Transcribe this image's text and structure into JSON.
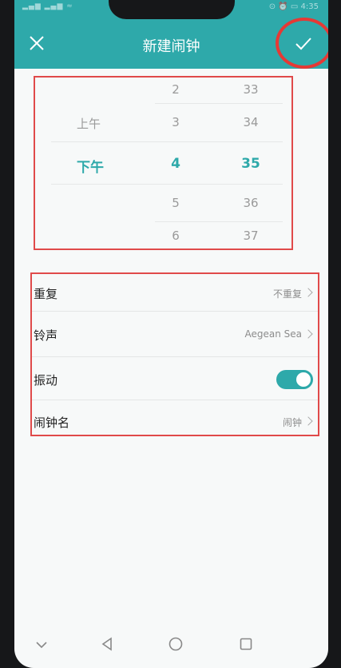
{
  "status_bar": {
    "left_icons": "▂▄▆ ▂▄▆ ≈",
    "right": "⊙ ⏰ ▭ 4:35"
  },
  "header": {
    "title": "新建闹钟"
  },
  "picker": {
    "ampm": {
      "above": "上午",
      "selected": "下午"
    },
    "hours": {
      "above2": "2",
      "above1": "3",
      "selected": "4",
      "below1": "5",
      "below2": "6"
    },
    "minutes": {
      "above2": "33",
      "above1": "34",
      "selected": "35",
      "below1": "36",
      "below2": "37"
    }
  },
  "settings": [
    {
      "label": "重复",
      "value": "不重复"
    },
    {
      "label": "铃声",
      "value": "Aegean Sea"
    },
    {
      "label": "振动",
      "toggle_on": true
    },
    {
      "label": "闹钟名",
      "value": "闹钟"
    }
  ],
  "colors": {
    "accent": "#2ea9aa",
    "highlight": "#e04a4a"
  }
}
